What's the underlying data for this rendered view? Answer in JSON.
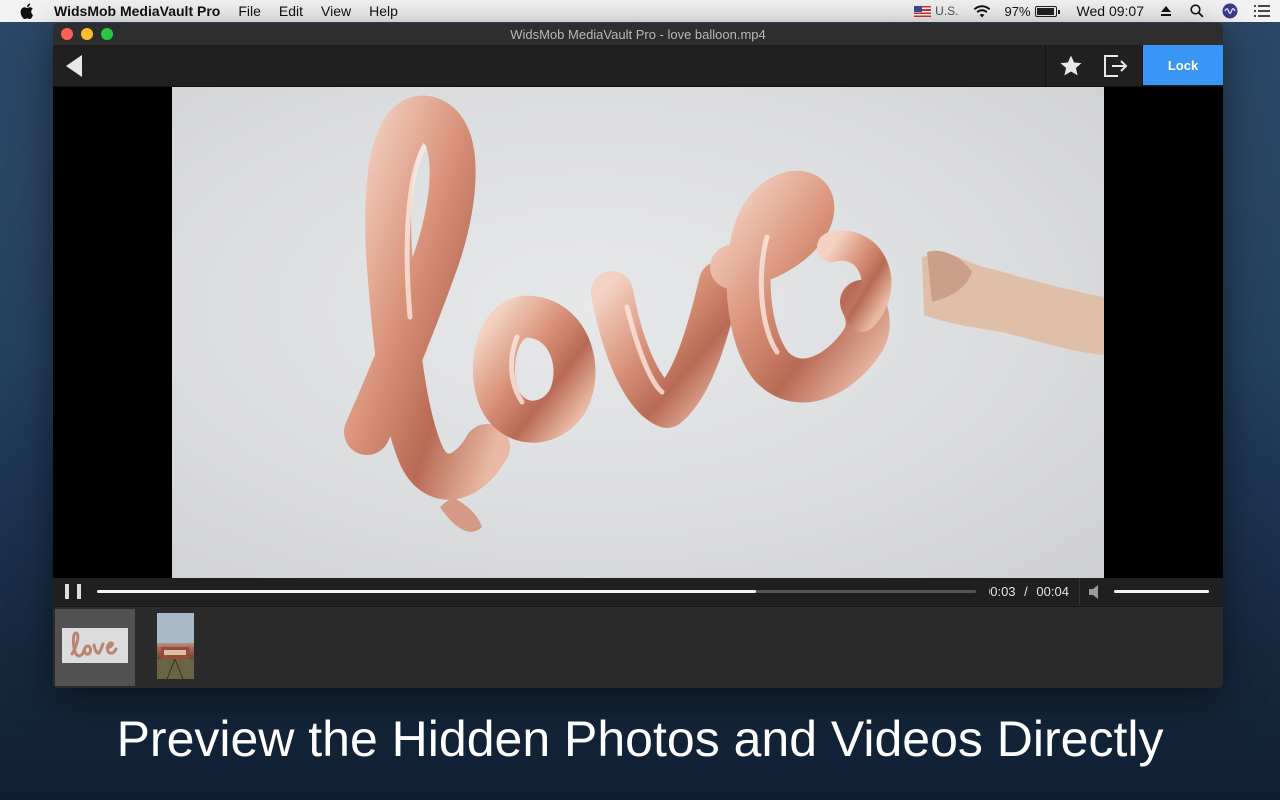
{
  "menubar": {
    "app_name": "WidsMob MediaVault Pro",
    "menus": [
      "File",
      "Edit",
      "View",
      "Help"
    ],
    "input_source": "U.S.",
    "battery": "97%",
    "clock": "Wed 09:07",
    "icons": [
      "apple-icon",
      "flag-icon",
      "wifi-icon",
      "battery-icon",
      "eject-icon",
      "search-icon",
      "siri-icon",
      "list-icon"
    ]
  },
  "window": {
    "title": "WidsMob MediaVault Pro - love balloon.mp4"
  },
  "toolbar": {
    "lock_label": "Lock",
    "icons": [
      "back-arrow-icon",
      "star-icon",
      "export-icon"
    ]
  },
  "player": {
    "current_time": "00:03",
    "separator": "/",
    "duration": "00:04",
    "progress": 0.75,
    "volume": 1.0,
    "state": "playing"
  },
  "filmstrip": {
    "items": [
      {
        "type": "video",
        "selected": true
      },
      {
        "type": "photo",
        "selected": false
      }
    ]
  },
  "caption": "Preview the Hidden Photos and Videos Directly",
  "colors": {
    "accent": "#3a96f5",
    "window_bg": "#232323"
  }
}
